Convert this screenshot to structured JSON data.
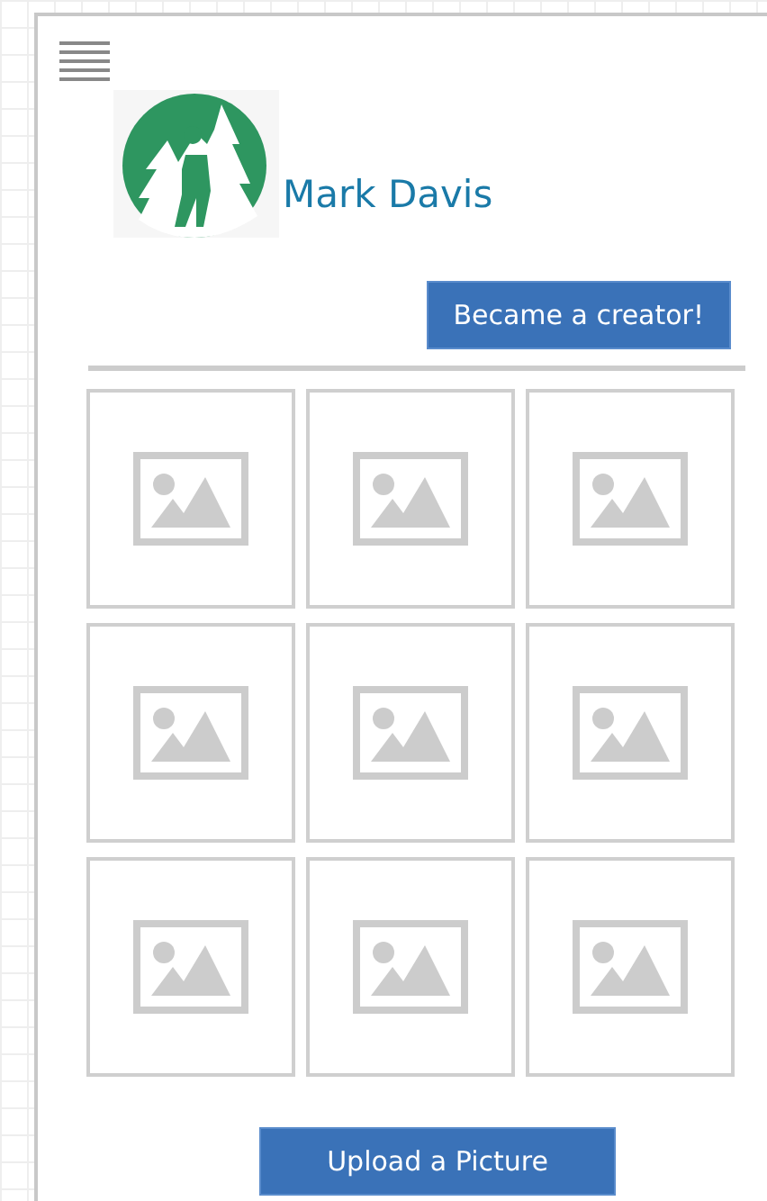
{
  "profile": {
    "name": "Mark Davis"
  },
  "creator_button": {
    "label": "Became a creator!"
  },
  "gallery": [
    {
      "kind": "placeholder"
    },
    {
      "kind": "placeholder"
    },
    {
      "kind": "placeholder"
    },
    {
      "kind": "placeholder"
    },
    {
      "kind": "placeholder"
    },
    {
      "kind": "placeholder"
    },
    {
      "kind": "placeholder"
    },
    {
      "kind": "placeholder"
    },
    {
      "kind": "placeholder"
    }
  ],
  "upload_button": {
    "label": "Upload a Picture"
  }
}
